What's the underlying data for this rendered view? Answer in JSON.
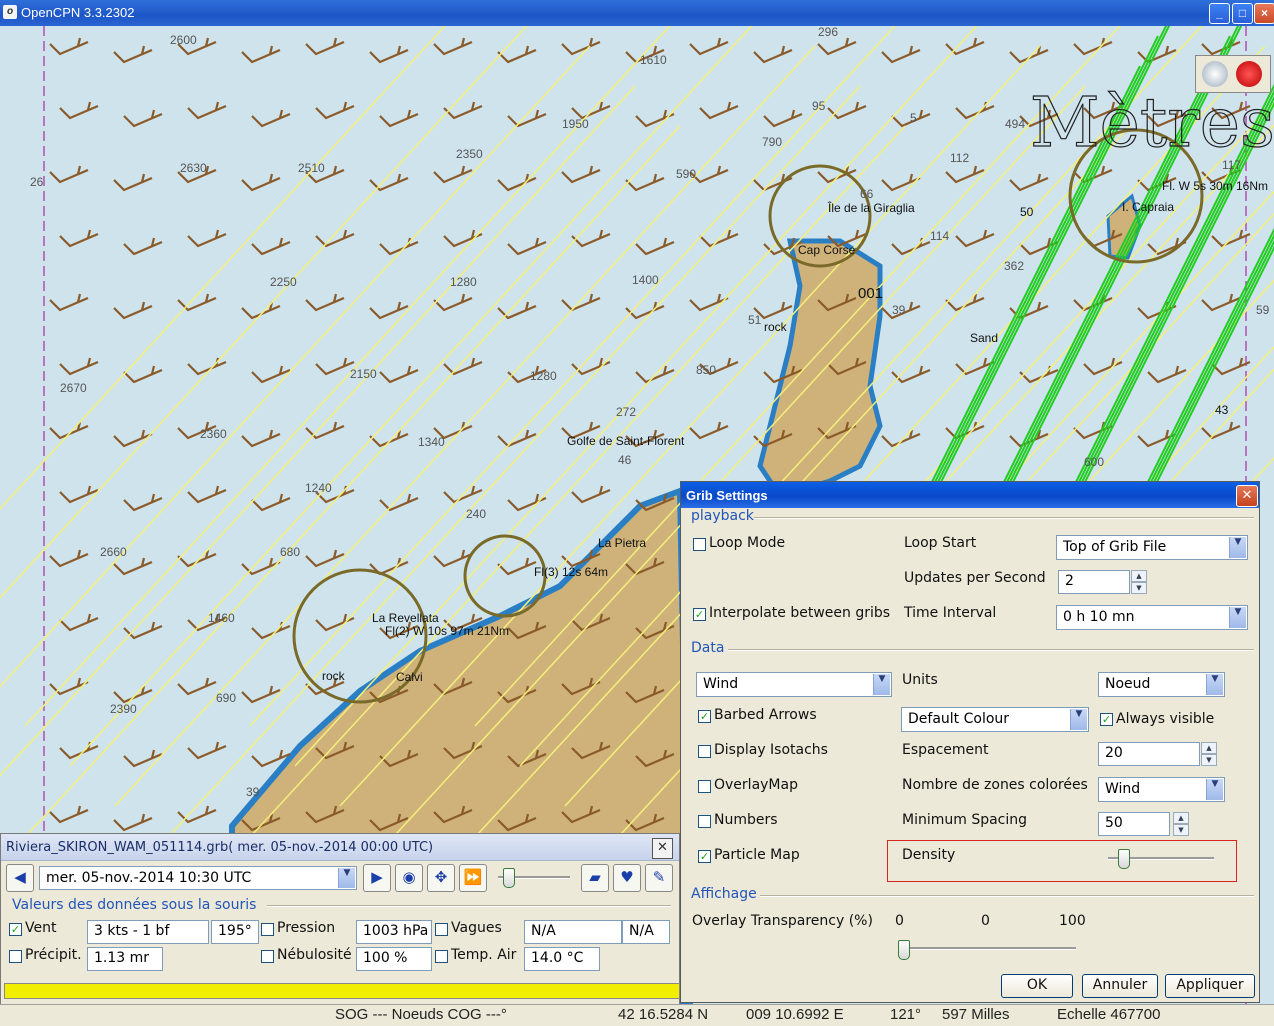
{
  "window": {
    "title": "OpenCPN 3.3.2302",
    "buttons": [
      "minimize",
      "maximize",
      "close"
    ]
  },
  "chart": {
    "watermark": "Mètres",
    "depths": [
      "2600",
      "1610",
      "296",
      "95",
      "5",
      "2630",
      "2510",
      "2350",
      "1950",
      "790",
      "590",
      "494",
      "112",
      "117",
      "26",
      "2250",
      "1280",
      "1400",
      "66",
      "114",
      "362",
      "59",
      "51",
      "39",
      "2150",
      "2670",
      "1280",
      "850",
      "272",
      "2360",
      "1340",
      "46",
      "600",
      "1240",
      "240",
      "2660",
      "680",
      "1460",
      "690",
      "2390",
      "39"
    ],
    "labels": [
      "Île de la Giraglia",
      "Cap Corse",
      "001",
      "rock",
      "Golfe de Saint-Florent",
      "La Pietra",
      "Fl(3) 12s 64m",
      "La Revellata",
      "Fl(2) W 10s 97m 21Nm",
      "rock",
      "Calvi",
      "I. Capraia",
      "Fl. W 5s 30m 16Nm",
      "Sand",
      "50",
      "43"
    ],
    "colors": {
      "sea": "#cfe3ec",
      "shallow": "#4aa5d8",
      "land": "#cfb27a",
      "barb": "#8a5a2a",
      "green": "#22cc22",
      "yellow": "#f4ef7a"
    }
  },
  "grib_panel": {
    "title": "Riviera_SKIRON_WAM_051114.grb( mer. 05-nov.-2014 00:00  UTC)",
    "time_select": "mer. 05-nov.-2014 10:30  UTC",
    "toolbar_icons": [
      "prev-icon",
      "time-select",
      "next-icon",
      "now-icon",
      "zoom-to-center-icon",
      "play-icon",
      "timeline-slider",
      "open-file-icon",
      "settings-icon",
      "request-icon"
    ],
    "values_header": "Valeurs des données sous la souris",
    "rows": {
      "vent_label": "Vent",
      "vent_speed": "3 kts -  1 bf",
      "vent_dir": "195°",
      "pression_label": "Pression",
      "pression_val": "1003 hPa",
      "vagues_label": "Vagues",
      "vagues_val1": "N/A",
      "vagues_val2": "N/A",
      "precip_label": "Précipit.",
      "precip_val": "1.13 mr",
      "nebul_label": "Nébulosité",
      "nebul_val": "100 %",
      "temp_label": "Temp. Air",
      "temp_val": "14.0 °C"
    },
    "checked": {
      "vent": true,
      "precip": false,
      "pression": false,
      "nebul": false,
      "vagues": false,
      "temp": false
    }
  },
  "grib_settings": {
    "title": "Grib Settings",
    "playback": {
      "section": "playback",
      "loop_mode": "Loop Mode",
      "loop_start_label": "Loop Start",
      "loop_start_value": "Top of Grib File",
      "updates_label": "Updates per Second",
      "updates_value": "2",
      "interpolate": "Interpolate between gribs",
      "time_interval_label": "Time Interval",
      "time_interval_value": "0 h 10 mn"
    },
    "data": {
      "section": "Data",
      "type_value": "Wind",
      "units_label": "Units",
      "units_value": "Noeud",
      "barbed_arrows": "Barbed Arrows",
      "colour_value": "Default Colour",
      "always_visible": "Always visible",
      "display_isotachs": "Display Isotachs",
      "espacement_label": "Espacement",
      "espacement_value": "20",
      "overlay_map": "OverlayMap",
      "zones_label": "Nombre de zones colorées",
      "zones_value": "Wind",
      "numbers": "Numbers",
      "min_spacing_label": "Minimum Spacing",
      "min_spacing_value": "50",
      "particle_map": "Particle Map",
      "density_label": "Density",
      "density_level": 0.1
    },
    "affichage": {
      "section": "Affichage",
      "overlay_label": "Overlay Transparency (%)",
      "min": "0",
      "current": "0",
      "max": "100",
      "transparency_level": 0
    },
    "checked": {
      "loop_mode": false,
      "interpolate": true,
      "barbed_arrows": true,
      "always_visible": true,
      "display_isotachs": false,
      "overlay_map": false,
      "numbers": false,
      "particle_map": true
    },
    "buttons": {
      "ok": "OK",
      "cancel": "Annuler",
      "apply": "Appliquer"
    }
  },
  "status": {
    "sog_cog": "SOG --- Noeuds COG ---°",
    "lat": "42 16.5284 N",
    "lon": "009 10.6992 E",
    "bearing": "121°",
    "distance": "597 Milles",
    "scale": "Echelle 467700"
  }
}
